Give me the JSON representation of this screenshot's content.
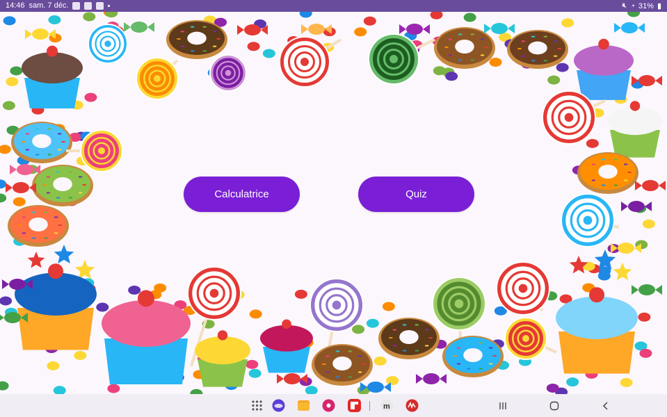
{
  "status_bar": {
    "time": "14:46",
    "date": "sam. 7 déc.",
    "battery": "31%"
  },
  "buttons": {
    "calculator": "Calculatrice",
    "quiz": "Quiz"
  },
  "colors": {
    "accent": "#7a1fd6",
    "status_bar": "#6a4c9c",
    "background": "#fbf7fc"
  },
  "dock": {
    "icons": [
      "apps-grid-icon",
      "internet-icon",
      "files-icon",
      "gallery-icon",
      "flipboard-icon",
      "m-app-icon",
      "signature-app-icon"
    ]
  },
  "system_nav": [
    "recent-apps-icon",
    "home-icon",
    "back-icon"
  ]
}
